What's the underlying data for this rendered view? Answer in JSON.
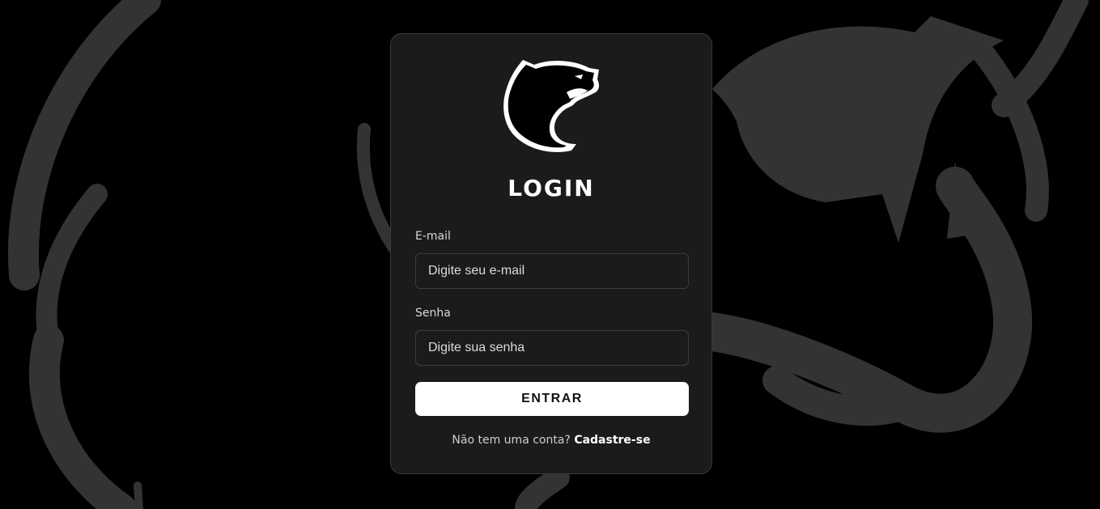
{
  "login": {
    "title": "LOGIN",
    "email_label": "E-mail",
    "email_placeholder": "Digite seu e-mail",
    "password_label": "Senha",
    "password_placeholder": "Digite sua senha",
    "submit_label": "ENTRAR",
    "signup_prompt": "Não tem uma conta?",
    "signup_link": "Cadastre-se"
  },
  "colors": {
    "page_background": "#000000",
    "card_background": "#1b1b1b",
    "background_art": "#333333",
    "button_background": "#ffffff"
  },
  "icons": {
    "logo": "panther-head-icon",
    "background": "panther-watermark-icon"
  }
}
